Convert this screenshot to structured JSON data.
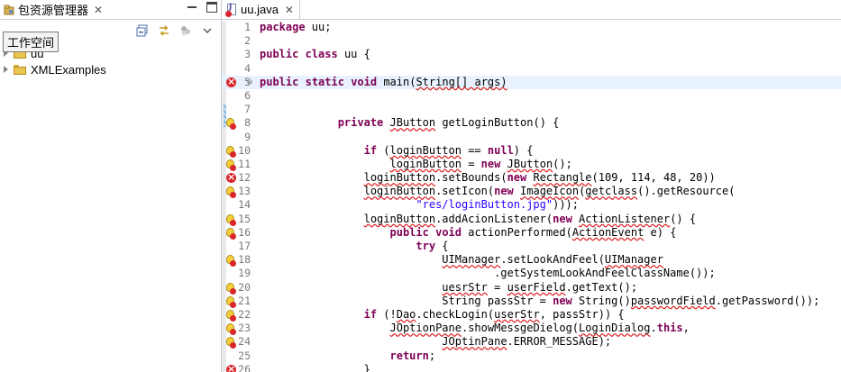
{
  "explorer": {
    "title": "包资源管理器",
    "tooltip": "工作空间",
    "tree": [
      {
        "label": "uu"
      },
      {
        "label": "XMLExamples"
      }
    ]
  },
  "editor": {
    "tab_title": "uu.java",
    "lines": [
      {
        "n": "1",
        "marker": "",
        "segs": [
          {
            "t": "package",
            "k": "kw"
          },
          {
            "t": " uu;"
          }
        ]
      },
      {
        "n": "2",
        "marker": "",
        "segs": [
          {
            "t": ""
          }
        ]
      },
      {
        "n": "3",
        "marker": "",
        "segs": [
          {
            "t": "public",
            "k": "kw"
          },
          {
            "t": " "
          },
          {
            "t": "class",
            "k": "kw"
          },
          {
            "t": " uu {"
          }
        ]
      },
      {
        "n": "4",
        "marker": "",
        "segs": [
          {
            "t": ""
          }
        ]
      },
      {
        "n": "5",
        "marker": "err",
        "fold": "⊖",
        "current": true,
        "segs": [
          {
            "t": "public",
            "k": "kw"
          },
          {
            "t": " "
          },
          {
            "t": "static",
            "k": "kw"
          },
          {
            "t": " "
          },
          {
            "t": "void",
            "k": "kw"
          },
          {
            "t": " main("
          },
          {
            "t": "String[] args)",
            "k": "err"
          }
        ]
      },
      {
        "n": "6",
        "marker": "",
        "segs": [
          {
            "t": ""
          }
        ]
      },
      {
        "n": "7",
        "marker": "",
        "segs": [
          {
            "t": ""
          }
        ]
      },
      {
        "n": "8",
        "marker": "bulb",
        "segs": [
          {
            "t": "            "
          },
          {
            "t": "private",
            "k": "kw"
          },
          {
            "t": " "
          },
          {
            "t": "JButton",
            "k": "err"
          },
          {
            "t": " getLoginButton() {"
          }
        ]
      },
      {
        "n": "9",
        "marker": "",
        "segs": [
          {
            "t": ""
          }
        ]
      },
      {
        "n": "10",
        "marker": "bulb",
        "segs": [
          {
            "t": "                "
          },
          {
            "t": "if",
            "k": "kw"
          },
          {
            "t": " ("
          },
          {
            "t": "loginButton",
            "k": "err"
          },
          {
            "t": " == "
          },
          {
            "t": "null",
            "k": "kw"
          },
          {
            "t": ") {"
          }
        ]
      },
      {
        "n": "11",
        "marker": "bulb",
        "segs": [
          {
            "t": "                    "
          },
          {
            "t": "loginButton",
            "k": "err"
          },
          {
            "t": " = "
          },
          {
            "t": "new",
            "k": "kw"
          },
          {
            "t": " "
          },
          {
            "t": "JButton",
            "k": "err"
          },
          {
            "t": "();"
          }
        ]
      },
      {
        "n": "12",
        "marker": "err",
        "segs": [
          {
            "t": "                "
          },
          {
            "t": "loginButton",
            "k": "err"
          },
          {
            "t": ".setBounds("
          },
          {
            "t": "new",
            "k": "kw"
          },
          {
            "t": " "
          },
          {
            "t": "Rectangle",
            "k": "err"
          },
          {
            "t": "(109, 114, 48, 20))"
          }
        ]
      },
      {
        "n": "13",
        "marker": "bulb",
        "segs": [
          {
            "t": "                "
          },
          {
            "t": "loginButton",
            "k": "err"
          },
          {
            "t": ".setIcon("
          },
          {
            "t": "new",
            "k": "kw"
          },
          {
            "t": " "
          },
          {
            "t": "ImageIcon",
            "k": "err"
          },
          {
            "t": "("
          },
          {
            "t": "getclass",
            "k": "err"
          },
          {
            "t": "().getResource("
          }
        ]
      },
      {
        "n": "14",
        "marker": "",
        "segs": [
          {
            "t": "                        "
          },
          {
            "t": "\"res/loginButton.jpg\"",
            "k": "str"
          },
          {
            "t": ")));"
          }
        ]
      },
      {
        "n": "15",
        "marker": "bulb",
        "segs": [
          {
            "t": "                "
          },
          {
            "t": "loginButton",
            "k": "err"
          },
          {
            "t": ".addAcionListener("
          },
          {
            "t": "new",
            "k": "kw"
          },
          {
            "t": " "
          },
          {
            "t": "ActionListener",
            "k": "err"
          },
          {
            "t": "() {"
          }
        ]
      },
      {
        "n": "16",
        "marker": "bulb",
        "segs": [
          {
            "t": "                    "
          },
          {
            "t": "public",
            "k": "kw"
          },
          {
            "t": " "
          },
          {
            "t": "void",
            "k": "kw"
          },
          {
            "t": " actionPerformed("
          },
          {
            "t": "ActionEvent",
            "k": "err"
          },
          {
            "t": " e) {"
          }
        ]
      },
      {
        "n": "17",
        "marker": "",
        "segs": [
          {
            "t": "                        "
          },
          {
            "t": "try",
            "k": "kw"
          },
          {
            "t": " {"
          }
        ]
      },
      {
        "n": "18",
        "marker": "bulb",
        "segs": [
          {
            "t": "                            "
          },
          {
            "t": "UIManager",
            "k": "err"
          },
          {
            "t": ".setLookAndFeel("
          },
          {
            "t": "UIManager",
            "k": "err"
          }
        ]
      },
      {
        "n": "19",
        "marker": "",
        "segs": [
          {
            "t": "                                    .getSystemLookAndFeelClassName());"
          }
        ]
      },
      {
        "n": "20",
        "marker": "bulb",
        "segs": [
          {
            "t": "                            "
          },
          {
            "t": "uesrStr",
            "k": "err"
          },
          {
            "t": " = "
          },
          {
            "t": "userField",
            "k": "err"
          },
          {
            "t": ".getText();"
          }
        ]
      },
      {
        "n": "21",
        "marker": "bulb",
        "segs": [
          {
            "t": "                            String passStr = "
          },
          {
            "t": "new",
            "k": "kw"
          },
          {
            "t": " String()"
          },
          {
            "t": "passwordField",
            "k": "err"
          },
          {
            "t": ".getPassword());"
          }
        ]
      },
      {
        "n": "22",
        "marker": "bulb",
        "segs": [
          {
            "t": "                "
          },
          {
            "t": "if",
            "k": "kw"
          },
          {
            "t": " (!"
          },
          {
            "t": "Dao",
            "k": "err"
          },
          {
            "t": ".checkLogin("
          },
          {
            "t": "userStr",
            "k": "err"
          },
          {
            "t": ", passStr)) {"
          }
        ]
      },
      {
        "n": "23",
        "marker": "bulb",
        "segs": [
          {
            "t": "                    "
          },
          {
            "t": "JOptionPane",
            "k": "err"
          },
          {
            "t": ".showMessgeDielog("
          },
          {
            "t": "LoginDialog",
            "k": "err"
          },
          {
            "t": "."
          },
          {
            "t": "this",
            "k": "kw"
          },
          {
            "t": ","
          }
        ]
      },
      {
        "n": "24",
        "marker": "bulb",
        "segs": [
          {
            "t": "                            "
          },
          {
            "t": "JOptinPane",
            "k": "err"
          },
          {
            "t": ".ERROR_MESSAGE);"
          }
        ]
      },
      {
        "n": "25",
        "marker": "",
        "segs": [
          {
            "t": "                    "
          },
          {
            "t": "return",
            "k": "kw"
          },
          {
            "t": ";"
          }
        ]
      },
      {
        "n": "26",
        "marker": "err",
        "segs": [
          {
            "t": "                }"
          }
        ]
      }
    ]
  },
  "colors": {
    "keyword": "#7f0055",
    "string": "#2a00ff",
    "error": "#d9262b",
    "current_line": "#e8f2fe",
    "line_number": "#787878"
  }
}
